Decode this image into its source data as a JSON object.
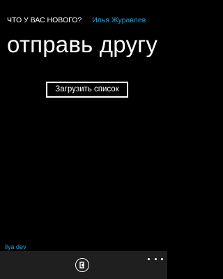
{
  "header": {
    "app_title": "ЧТО У ВАС НОВОГО?",
    "user_name": "Илья Журавлев"
  },
  "page": {
    "title": "отправь другу",
    "load_button_label": "Загрузить список"
  },
  "footer": {
    "label": "ilya dev"
  },
  "app_bar": {
    "button_icon": "send-icon",
    "more_icon": "ellipsis-icon"
  },
  "colors": {
    "background": "#000000",
    "accent": "#2a9fd6",
    "app_bar": "#1f1f1f"
  }
}
